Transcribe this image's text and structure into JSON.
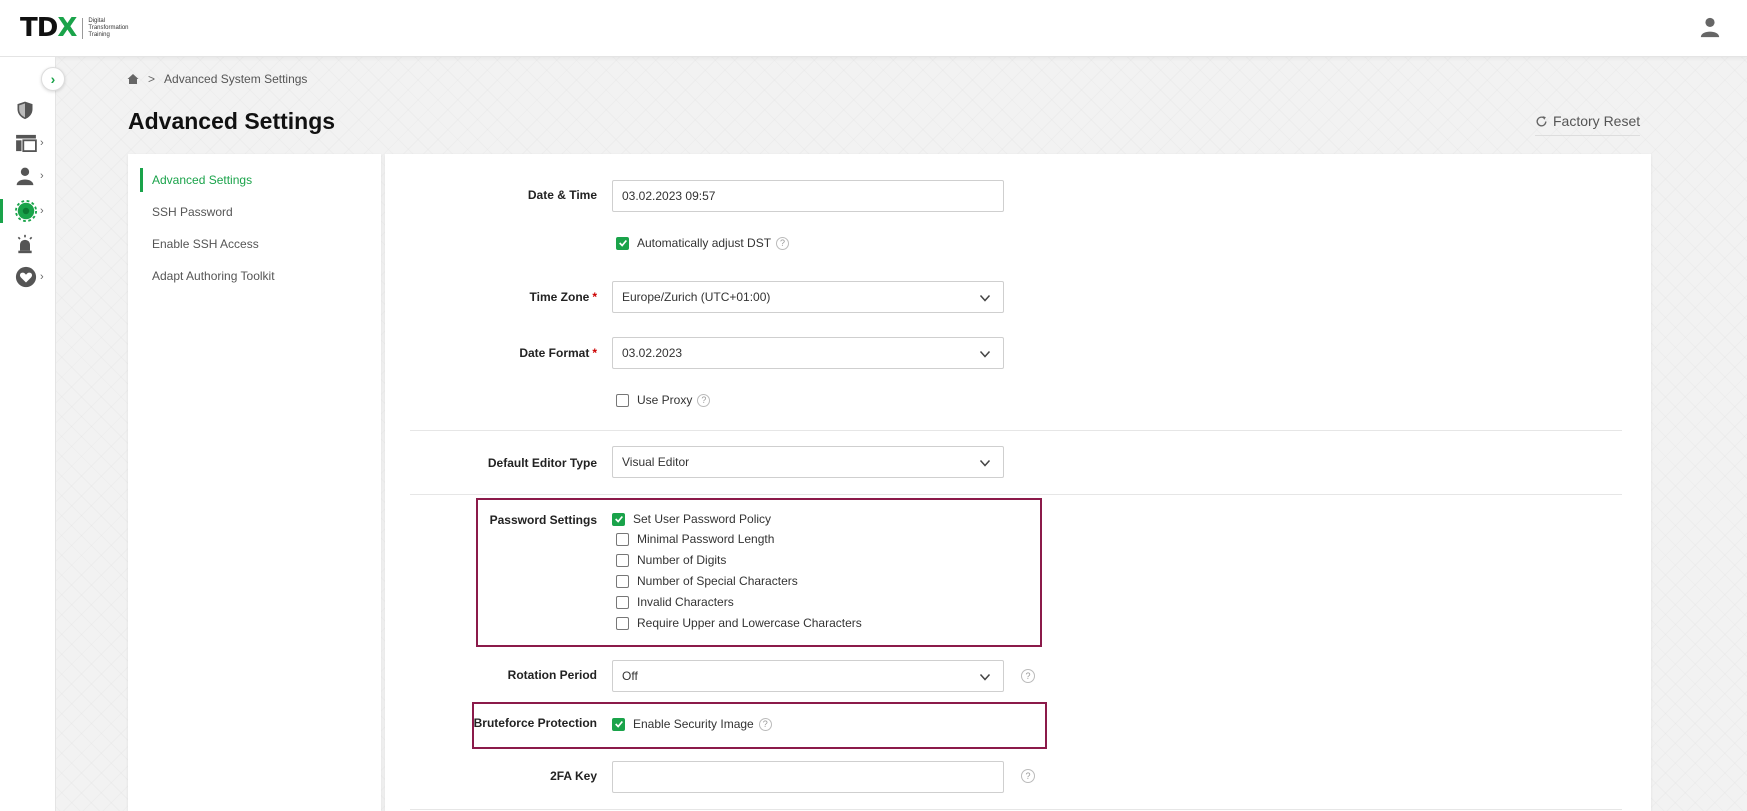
{
  "header": {
    "logo_text_a": "TD",
    "logo_text_b": "X",
    "logo_sub_1": "Digital",
    "logo_sub_2": "Transformation",
    "logo_sub_3": "Training",
    "user_icon": "user-icon"
  },
  "rail": {
    "toggle_icon": "chevron-right-icon",
    "items": [
      {
        "icon": "shield-icon",
        "has_chevron": false
      },
      {
        "icon": "dashboard-icon",
        "has_chevron": true
      },
      {
        "icon": "users-icon",
        "has_chevron": true
      },
      {
        "icon": "settings-gear-icon",
        "has_chevron": true,
        "active": true
      },
      {
        "icon": "alarm-icon",
        "has_chevron": false
      },
      {
        "icon": "heart-icon",
        "has_chevron": true
      }
    ],
    "chevron": "›"
  },
  "breadcrumb": {
    "home_icon": "home-icon",
    "separator": ">",
    "current": "Advanced System Settings"
  },
  "page": {
    "title": "Advanced Settings",
    "factory_reset": "Factory Reset"
  },
  "side_nav": [
    {
      "label": "Advanced Settings",
      "active": true
    },
    {
      "label": "SSH Password"
    },
    {
      "label": "Enable SSH Access"
    },
    {
      "label": "Adapt Authoring Toolkit"
    }
  ],
  "form": {
    "date_time": {
      "label": "Date & Time",
      "value": "03.02.2023 09:57"
    },
    "auto_dst": {
      "label": "Automatically adjust DST",
      "checked": true
    },
    "time_zone": {
      "label": "Time Zone",
      "required": "*",
      "value": "Europe/Zurich (UTC+01:00)"
    },
    "date_format": {
      "label": "Date Format",
      "required": "*",
      "value": "03.02.2023"
    },
    "use_proxy": {
      "label": "Use Proxy",
      "checked": false
    },
    "editor_type": {
      "label": "Default Editor Type",
      "value": "Visual Editor"
    },
    "password_settings": {
      "label": "Password Settings",
      "options": [
        {
          "label": "Set User Password Policy",
          "checked": true
        },
        {
          "label": "Minimal Password Length",
          "checked": false
        },
        {
          "label": "Number of Digits",
          "checked": false
        },
        {
          "label": "Number of Special Characters",
          "checked": false
        },
        {
          "label": "Invalid Characters",
          "checked": false
        },
        {
          "label": "Require Upper and Lowercase Characters",
          "checked": false
        }
      ]
    },
    "rotation_period": {
      "label": "Rotation Period",
      "value": "Off"
    },
    "bruteforce": {
      "label": "Bruteforce Protection",
      "option": "Enable Security Image",
      "checked": true
    },
    "twofa_key": {
      "label": "2FA Key",
      "value": ""
    },
    "help_glyph": "?"
  },
  "colors": {
    "accent": "#1aa34a",
    "highlight": "#8b1a4a"
  }
}
